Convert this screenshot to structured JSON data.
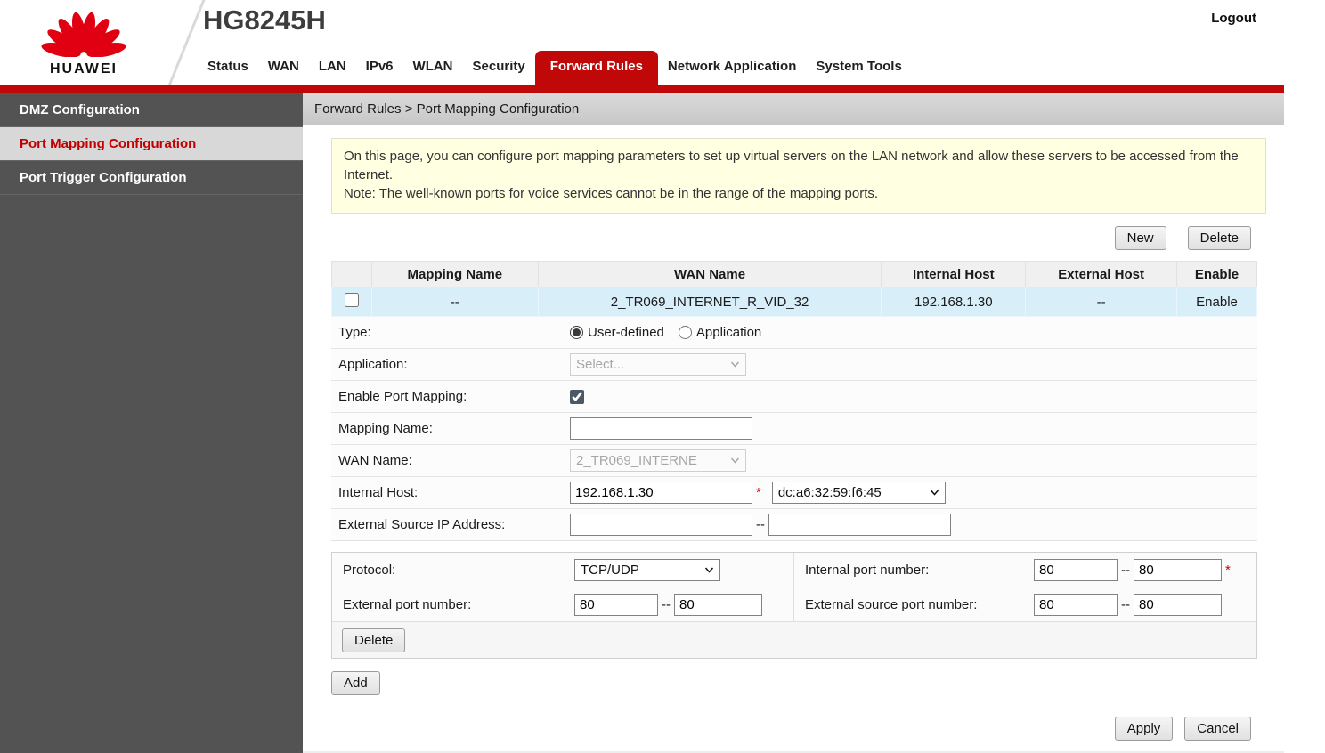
{
  "header": {
    "brand": "HUAWEI",
    "model": "HG8245H",
    "logout": "Logout",
    "nav": [
      {
        "label": "Status"
      },
      {
        "label": "WAN"
      },
      {
        "label": "LAN"
      },
      {
        "label": "IPv6"
      },
      {
        "label": "WLAN"
      },
      {
        "label": "Security"
      },
      {
        "label": "Forward Rules",
        "active": true
      },
      {
        "label": "Network Application"
      },
      {
        "label": "System Tools"
      }
    ]
  },
  "sidebar": {
    "items": [
      {
        "label": "DMZ Configuration"
      },
      {
        "label": "Port Mapping Configuration",
        "selected": true
      },
      {
        "label": "Port Trigger Configuration"
      }
    ]
  },
  "breadcrumb": "Forward Rules > Port Mapping Configuration",
  "info": {
    "line1": "On this page, you can configure port mapping parameters to set up virtual servers on the LAN network and allow these servers to be accessed from the Internet.",
    "line2": "Note: The well-known ports for voice services cannot be in the range of the mapping ports."
  },
  "actions": {
    "new": "New",
    "delete": "Delete",
    "add": "Add",
    "apply": "Apply",
    "cancel": "Cancel"
  },
  "table": {
    "headers": [
      "Mapping Name",
      "WAN Name",
      "Internal Host",
      "External Host",
      "Enable"
    ],
    "row": {
      "checked": false,
      "mapping_name": "--",
      "wan_name": "2_TR069_INTERNET_R_VID_32",
      "internal_host": "192.168.1.30",
      "external_host": "--",
      "enable": "Enable"
    }
  },
  "form": {
    "type": {
      "label": "Type:",
      "options": [
        {
          "label": "User-defined",
          "checked": true
        },
        {
          "label": "Application",
          "checked": false
        }
      ]
    },
    "application": {
      "label": "Application:",
      "value": "Select..."
    },
    "enable_port_mapping": {
      "label": "Enable Port Mapping:",
      "checked": true
    },
    "mapping_name": {
      "label": "Mapping Name:",
      "value": ""
    },
    "wan_name": {
      "label": "WAN Name:",
      "value": "2_TR069_INTERNE"
    },
    "internal_host": {
      "label": "Internal Host:",
      "value": "192.168.1.30",
      "required": "*",
      "mac": "dc:a6:32:59:f6:45"
    },
    "external_source_ip": {
      "label": "External Source IP Address:",
      "from": "",
      "to": "",
      "separator": "--"
    }
  },
  "ports": {
    "protocol": {
      "label": "Protocol:",
      "value": "TCP/UDP"
    },
    "internal_port": {
      "label": "Internal port number:",
      "from": "80",
      "to": "80",
      "required": "*"
    },
    "external_port": {
      "label": "External port number:",
      "from": "80",
      "to": "80"
    },
    "external_source_port": {
      "label": "External source port number:",
      "from": "80",
      "to": "80"
    },
    "separator": "--",
    "delete_label": "Delete"
  }
}
